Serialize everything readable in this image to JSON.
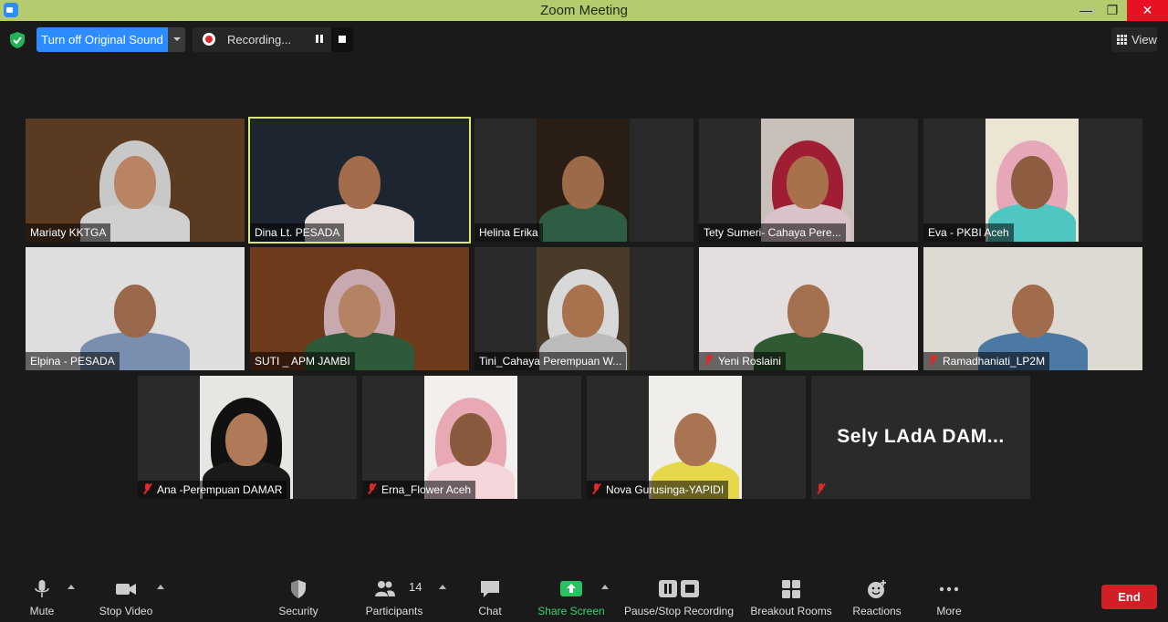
{
  "window": {
    "title": "Zoom Meeting"
  },
  "topbar": {
    "original_sound_label": "Turn off Original Sound",
    "recording_label": "Recording...",
    "view_label": "View"
  },
  "participants": [
    {
      "name": "Mariaty KKTGA",
      "muted": false,
      "bg": "#5b3a22",
      "skin": "#b88463",
      "cloth": "#cfcfcf",
      "hijab": "#c8c8c8"
    },
    {
      "name": "Dina Lt. PESADA",
      "muted": false,
      "bg": "#1d2630",
      "skin": "#a36c4a",
      "cloth": "#e6dcdc",
      "hijab": "",
      "active": true
    },
    {
      "name": "Helina Erika",
      "muted": false,
      "bg": "#2a1d14",
      "skin": "#9b6a48",
      "cloth": "#2e5d43",
      "hijab": ""
    },
    {
      "name": "Tety Sumeri- Cahaya Pere...",
      "muted": false,
      "bg": "#c8bfb8",
      "skin": "#a8714e",
      "cloth": "#d9c2c9",
      "hijab": "#a01e34"
    },
    {
      "name": "Eva - PKBI Aceh",
      "muted": false,
      "bg": "#ece5d4",
      "skin": "#8e5d40",
      "cloth": "#4fc6c2",
      "hijab": "#e6a8b8"
    },
    {
      "name": "Elpina - PESADA",
      "muted": false,
      "bg": "#dedede",
      "skin": "#9a684a",
      "cloth": "#7a8fb0",
      "hijab": ""
    },
    {
      "name": "SUTI _ APM JAMBI",
      "muted": false,
      "bg": "#6e3a1c",
      "skin": "#b48363",
      "cloth": "#2f5a3a",
      "hijab": "#c9a9b0"
    },
    {
      "name": "Tini_Cahaya Perempuan W...",
      "muted": false,
      "bg": "#4a3a2a",
      "skin": "#a8724f",
      "cloth": "#bcbcbc",
      "hijab": "#d8d8d8"
    },
    {
      "name": "Yeni Roslaini",
      "muted": true,
      "bg": "#e4dede",
      "skin": "#a3714f",
      "cloth": "#2f5a33",
      "hijab": ""
    },
    {
      "name": "Ramadhaniati_LP2M",
      "muted": true,
      "bg": "#dcdad2",
      "skin": "#a06c4c",
      "cloth": "#4b79a4",
      "hijab": ""
    },
    {
      "name": "Ana -Perempuan DAMAR",
      "muted": true,
      "bg": "#e8e6e2",
      "skin": "#b07a58",
      "cloth": "#1a1a1a",
      "hijab": "#111111"
    },
    {
      "name": "Erna_Flower Aceh",
      "muted": true,
      "bg": "#f2efec",
      "skin": "#8a5a3e",
      "cloth": "#f4d6da",
      "hijab": "#e8a8b4"
    },
    {
      "name": "Nova Gurusinga-YAPIDI",
      "muted": true,
      "bg": "#f0eeea",
      "skin": "#a87452",
      "cloth": "#e6d84a",
      "hijab": ""
    },
    {
      "name": "",
      "muted": true,
      "display_text": "Sely  LAdA  DAM..."
    }
  ],
  "toolbar": {
    "mute": "Mute",
    "stop_video": "Stop Video",
    "security": "Security",
    "participants": "Participants",
    "participants_count": "14",
    "chat": "Chat",
    "share_screen": "Share Screen",
    "pause_stop_recording": "Pause/Stop Recording",
    "breakout_rooms": "Breakout Rooms",
    "reactions": "Reactions",
    "more": "More",
    "end": "End"
  },
  "colors": {
    "titlebar": "#b5cc6e",
    "accent_blue": "#2d8cff",
    "active_speaker": "#d8e86a",
    "share_green": "#3cd070",
    "end_red": "#d11f26",
    "muted_red": "#e02828"
  },
  "icons": {
    "mute": "microphone-icon",
    "stop_video": "video-camera-icon",
    "security": "shield-icon",
    "participants": "people-icon",
    "chat": "chat-bubble-icon",
    "share_screen": "share-arrow-icon",
    "recording": "pause-stop-icon",
    "breakout": "grid-squares-icon",
    "reactions": "smiley-plus-icon",
    "more": "ellipsis-icon"
  }
}
